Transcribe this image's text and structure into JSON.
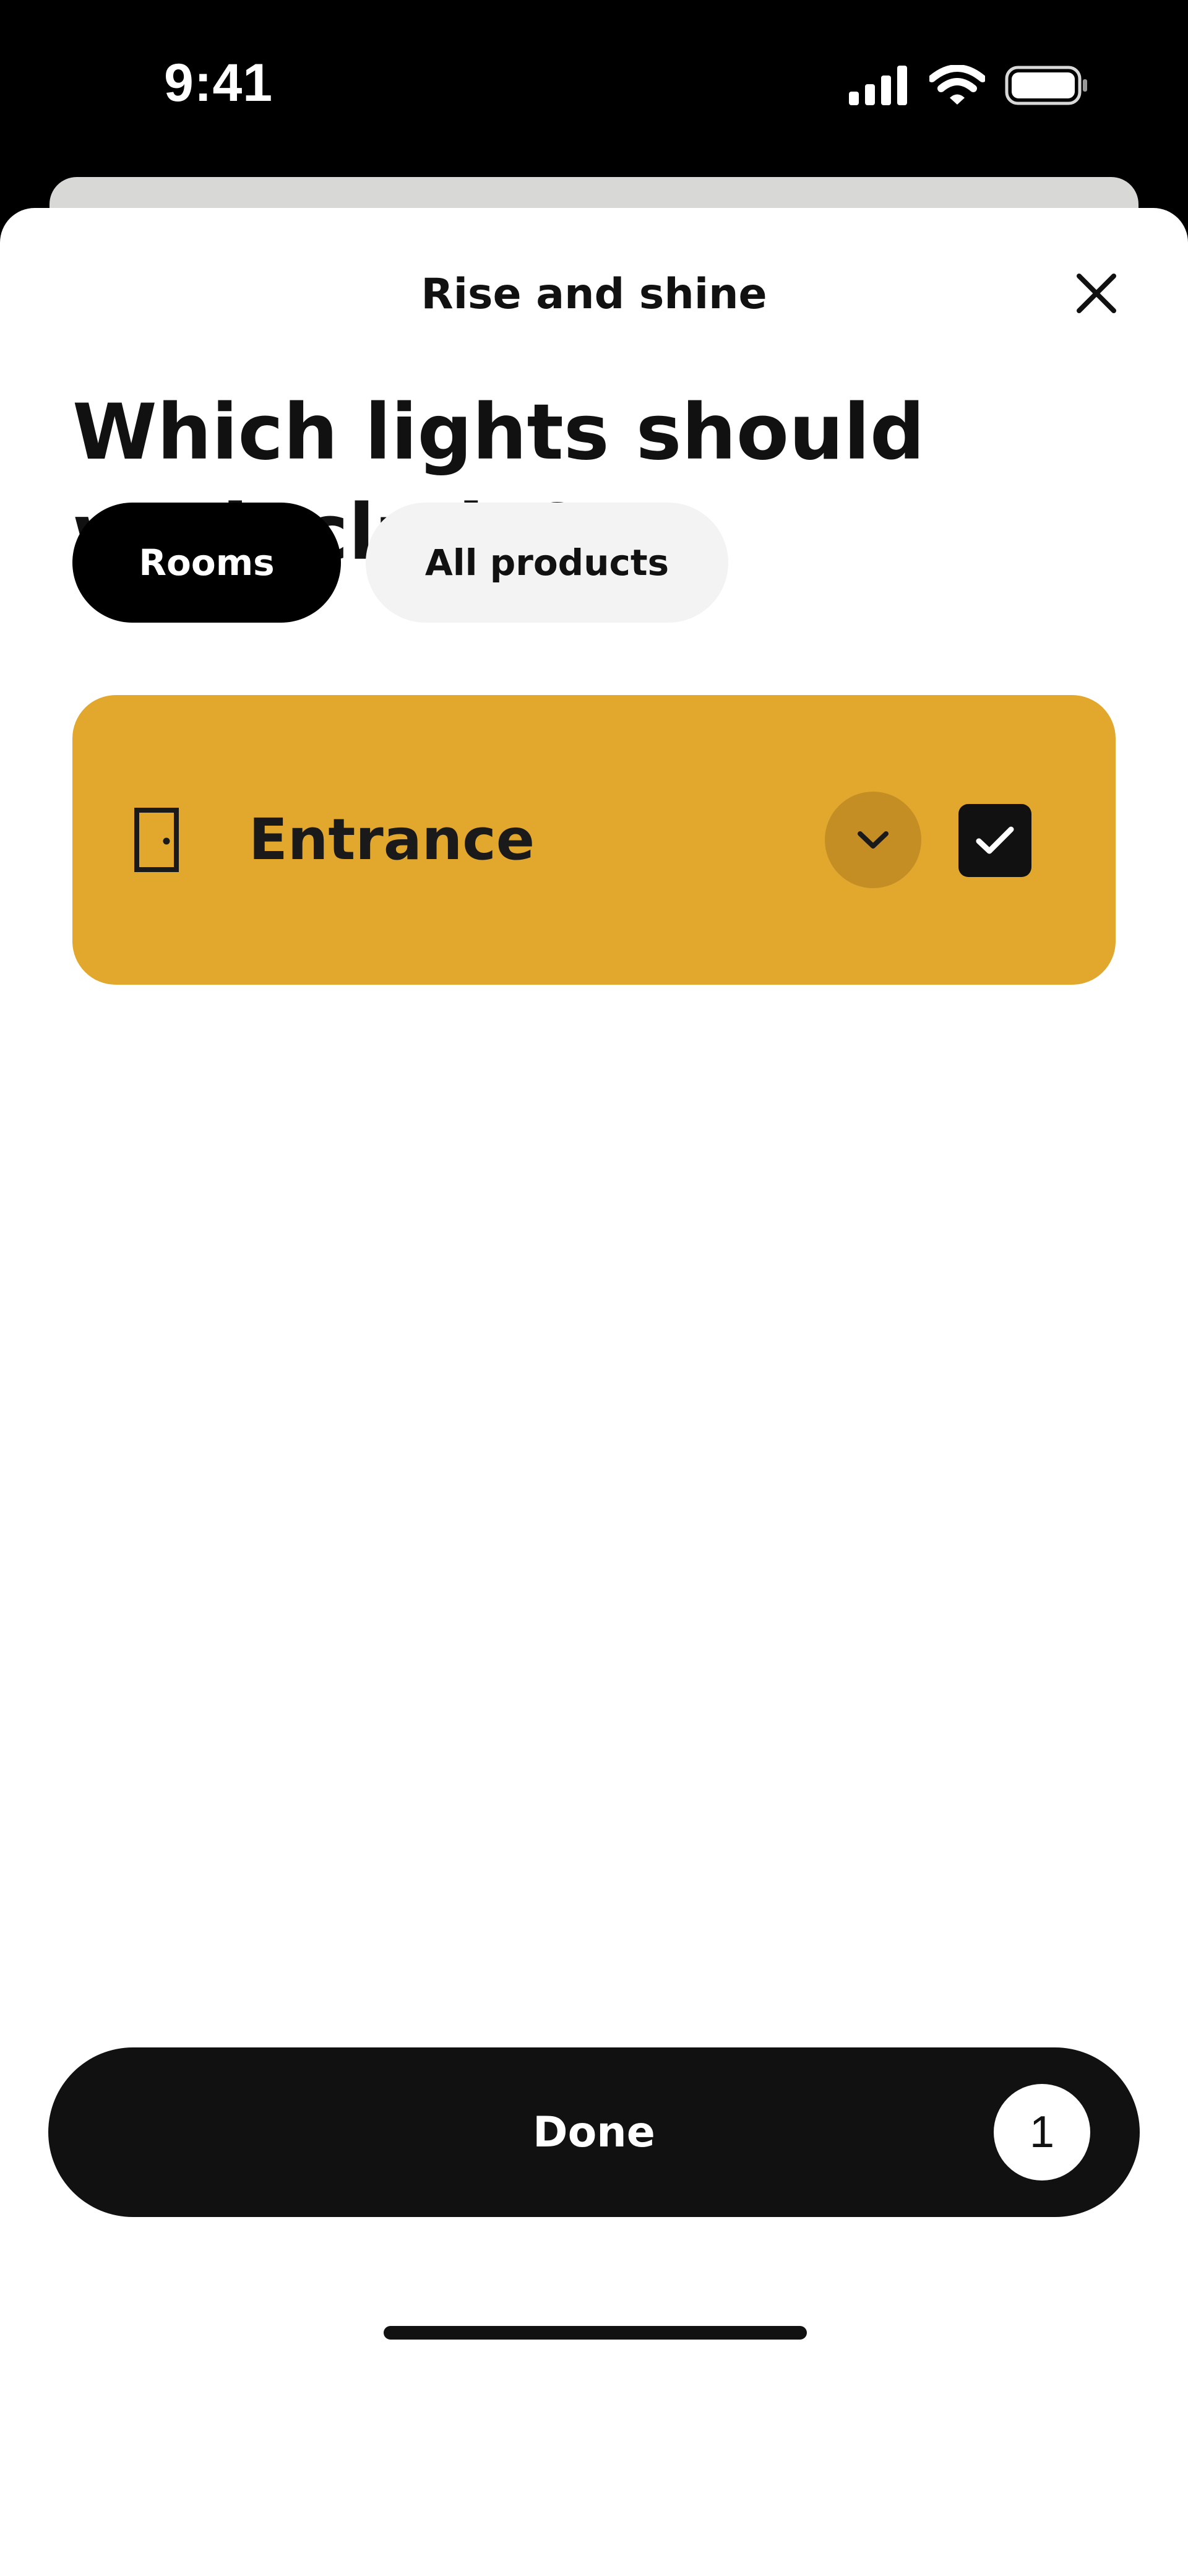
{
  "status_bar": {
    "time": "9:41",
    "icons": [
      "cellular-signal-icon",
      "wifi-icon",
      "battery-icon"
    ]
  },
  "sheet": {
    "title": "Rise and shine",
    "close_icon": "close-icon"
  },
  "heading": {
    "line1": "Which lights should",
    "line2": "we include?"
  },
  "tabs": [
    {
      "label": "Rooms",
      "selected": true
    },
    {
      "label": "All products",
      "selected": false
    }
  ],
  "rooms": [
    {
      "label": "Entrance",
      "icon": "door-icon",
      "checked": true,
      "expanded": false
    }
  ],
  "footer": {
    "done_label": "Done",
    "selected_count": "1"
  },
  "colors": {
    "accent": "#e2a72d",
    "accent_dark": "#c48e24",
    "primary": "#111111",
    "tab_inactive": "#f3f3f3"
  }
}
